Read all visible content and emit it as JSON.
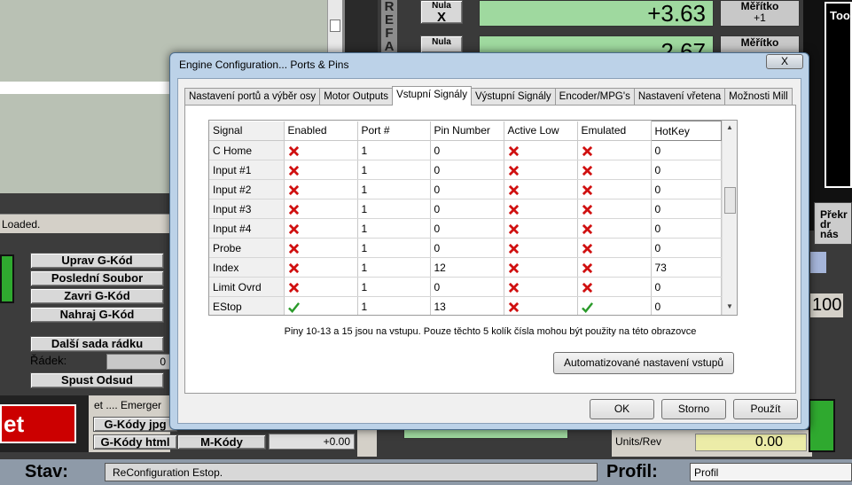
{
  "background": {
    "nula_x_label": "Nula",
    "nula_x_axis": "X",
    "nula_y_label": "Nula",
    "dro_x": "+3.63",
    "dro_y": "2.67",
    "meritko1_label": "Měřítko",
    "meritko1_value": "+1",
    "meritko2_label": "Měřítko",
    "ref_label": "R E F A",
    "loaded_text": "Loaded.",
    "buttons": [
      "Uprav G-Kód",
      "Poslední Soubor",
      "Zavri G-Kód",
      "Nahraj G-Kód",
      "Další sada rádku",
      "Spust Odsud"
    ],
    "radek_label": "Řádek:",
    "radek_value": "0",
    "reset_label": "et",
    "emergency_text": "et .... Emerger",
    "gkody_jpg": "G-Kódy jpg",
    "gkody_html": "G-Kódy html",
    "mkody": "M-Kódy",
    "offset_value": "+0.00",
    "units_rev_label": "Units/Rev",
    "units_rev_value": "0.00",
    "right_number": "100",
    "tool_label": "Too",
    "prek_label": "Překr\ndr\nnás",
    "stav_label": "Stav:",
    "stav_value": "ReConfiguration Estop.",
    "profil_label": "Profil:",
    "profil_value": "Profil"
  },
  "dialog": {
    "title": "Engine Configuration... Ports & Pins",
    "close_label": "X",
    "tabs": [
      {
        "label": "Nastavení portů a výběr osy",
        "active": false
      },
      {
        "label": "Motor Outputs",
        "active": false
      },
      {
        "label": "Vstupní Signály",
        "active": true
      },
      {
        "label": "Výstupní Signály",
        "active": false
      },
      {
        "label": "Encoder/MPG's",
        "active": false
      },
      {
        "label": "Nastavení vřetena",
        "active": false
      },
      {
        "label": "Možnosti Mill",
        "active": false
      }
    ],
    "columns": [
      "Signal",
      "Enabled",
      "Port #",
      "Pin Number",
      "Active Low",
      "Emulated",
      "HotKey"
    ],
    "rows": [
      {
        "signal": "C Home",
        "enabled": false,
        "port": "1",
        "pin": "0",
        "active_low": false,
        "emulated": false,
        "hotkey": "0"
      },
      {
        "signal": "Input #1",
        "enabled": false,
        "port": "1",
        "pin": "0",
        "active_low": false,
        "emulated": false,
        "hotkey": "0"
      },
      {
        "signal": "Input #2",
        "enabled": false,
        "port": "1",
        "pin": "0",
        "active_low": false,
        "emulated": false,
        "hotkey": "0"
      },
      {
        "signal": "Input #3",
        "enabled": false,
        "port": "1",
        "pin": "0",
        "active_low": false,
        "emulated": false,
        "hotkey": "0"
      },
      {
        "signal": "Input #4",
        "enabled": false,
        "port": "1",
        "pin": "0",
        "active_low": false,
        "emulated": false,
        "hotkey": "0"
      },
      {
        "signal": "Probe",
        "enabled": false,
        "port": "1",
        "pin": "0",
        "active_low": false,
        "emulated": false,
        "hotkey": "0"
      },
      {
        "signal": "Index",
        "enabled": false,
        "port": "1",
        "pin": "12",
        "active_low": false,
        "emulated": false,
        "hotkey": "73"
      },
      {
        "signal": "Limit Ovrd",
        "enabled": false,
        "port": "1",
        "pin": "0",
        "active_low": false,
        "emulated": false,
        "hotkey": "0"
      },
      {
        "signal": "EStop",
        "enabled": true,
        "port": "1",
        "pin": "13",
        "active_low": false,
        "emulated": true,
        "hotkey": "0"
      }
    ],
    "note": "Piny 10-13 a 15 jsou na vstupu. Pouze těchto 5 kolík čísla mohou být použity na této obrazovce",
    "auto_button": "Automatizované nastavení vstupů",
    "ok_button": "OK",
    "storno_button": "Storno",
    "pouzit_button": "Použít"
  },
  "colors": {
    "cross": "#d01010",
    "check": "#2a9a2a",
    "dro_bg": "#9fd99f"
  }
}
